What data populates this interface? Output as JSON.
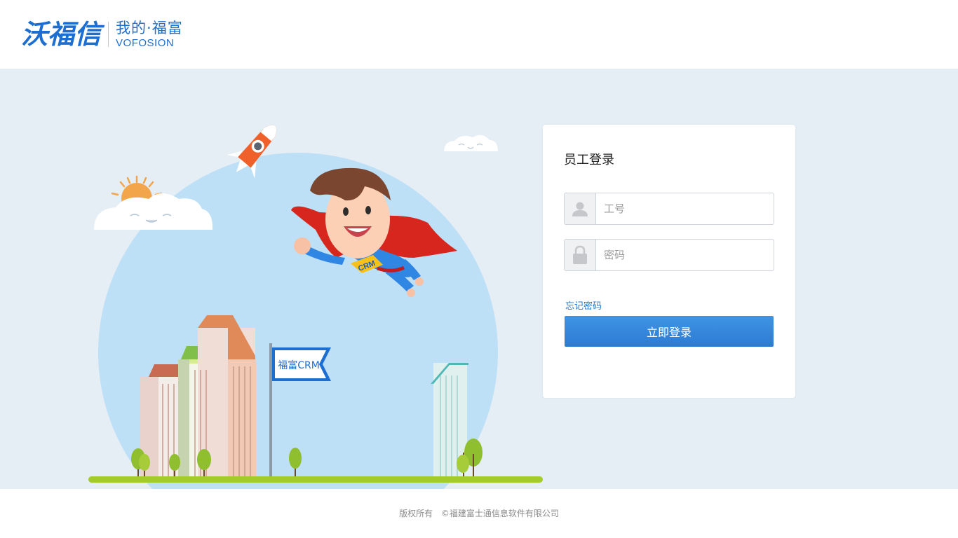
{
  "header": {
    "logo_main": "沃福信",
    "logo_sub_cn": "我的·福富",
    "logo_sub_en": "VOFOSION"
  },
  "illustration": {
    "flag_text": "福富CRM",
    "badge_text": "CRM"
  },
  "login": {
    "title": "员工登录",
    "username_placeholder": "工号",
    "password_placeholder": "密码",
    "forgot_label": "忘记密码",
    "submit_label": "立即登录"
  },
  "footer": {
    "rights": "版权所有",
    "company": "©福建富士通信息软件有限公司"
  },
  "colors": {
    "brand": "#1c6fd1",
    "button": "#2f80d9",
    "background": "#e5edf5",
    "link": "#1c7ad6"
  }
}
